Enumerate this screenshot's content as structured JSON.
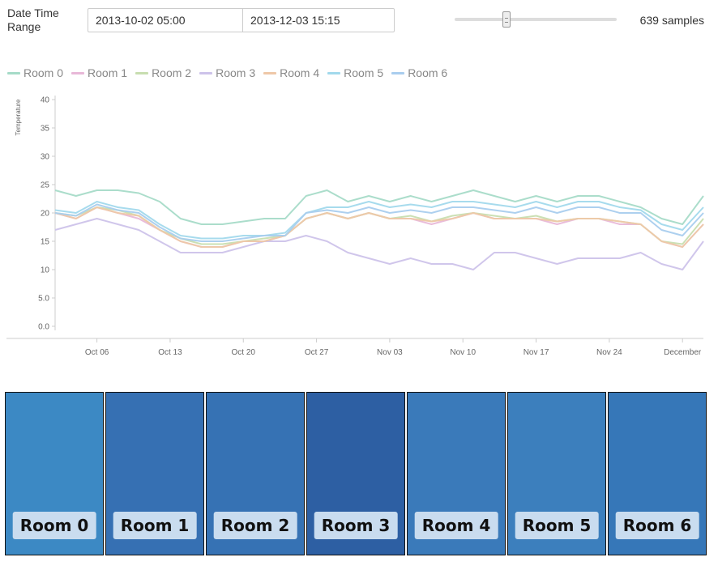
{
  "controls": {
    "date_range_label": "Date Time Range",
    "start_value": "2013-10-02 05:00",
    "end_value": "2013-12-03 15:15",
    "slider_value": 0.31,
    "samples_text": "639 samples"
  },
  "rooms": [
    {
      "name": "Room 0",
      "color": "#3c89c4"
    },
    {
      "name": "Room 1",
      "color": "#3670b3"
    },
    {
      "name": "Room 2",
      "color": "#3672b4"
    },
    {
      "name": "Room 3",
      "color": "#2d5fa3"
    },
    {
      "name": "Room 4",
      "color": "#3a7aba"
    },
    {
      "name": "Room 5",
      "color": "#3c7fbd"
    },
    {
      "name": "Room 6",
      "color": "#3677b8"
    }
  ],
  "chart_data": {
    "type": "line",
    "ylabel": "Temperature",
    "ylim": [
      0,
      40
    ],
    "yticks": [
      0,
      5,
      10,
      15,
      20,
      25,
      30,
      35,
      40
    ],
    "ytick_labels": [
      "0.0",
      "5.0",
      "10",
      "15",
      "20",
      "25",
      "30",
      "35",
      "40"
    ],
    "xlim": [
      "2013-10-02",
      "2013-12-03"
    ],
    "xticks": [
      "2013-10-06",
      "2013-10-13",
      "2013-10-20",
      "2013-10-27",
      "2013-11-03",
      "2013-11-10",
      "2013-11-17",
      "2013-11-24",
      "2013-12-01"
    ],
    "xtick_labels": [
      "Oct 06",
      "Oct 13",
      "Oct 20",
      "Oct 27",
      "Nov 03",
      "Nov 10",
      "Nov 17",
      "Nov 24",
      "December"
    ],
    "x": [
      "2013-10-02",
      "2013-10-04",
      "2013-10-06",
      "2013-10-08",
      "2013-10-10",
      "2013-10-12",
      "2013-10-14",
      "2013-10-16",
      "2013-10-18",
      "2013-10-20",
      "2013-10-22",
      "2013-10-24",
      "2013-10-26",
      "2013-10-28",
      "2013-10-30",
      "2013-11-01",
      "2013-11-03",
      "2013-11-05",
      "2013-11-07",
      "2013-11-09",
      "2013-11-11",
      "2013-11-13",
      "2013-11-15",
      "2013-11-17",
      "2013-11-19",
      "2013-11-21",
      "2013-11-23",
      "2013-11-25",
      "2013-11-27",
      "2013-11-29",
      "2013-12-01",
      "2013-12-03"
    ],
    "legend_position": "top-left",
    "grid": false,
    "series": [
      {
        "name": "Room 0",
        "color": "#a6dbc8",
        "values": [
          24,
          23,
          24,
          24,
          23.5,
          22,
          19,
          18,
          18,
          18.5,
          19,
          19,
          23,
          24,
          22,
          23,
          22,
          23,
          22,
          23,
          24,
          23,
          22,
          23,
          22,
          23,
          23,
          22,
          21,
          19,
          18,
          23
        ]
      },
      {
        "name": "Room 1",
        "color": "#e8b8d8",
        "values": [
          20,
          19,
          21,
          20,
          19,
          17,
          15,
          14,
          14,
          15,
          15,
          16,
          19,
          20,
          19,
          20,
          19,
          19,
          18,
          19,
          20,
          19,
          19,
          19,
          18,
          19,
          19,
          18,
          18,
          15,
          14,
          18
        ]
      },
      {
        "name": "Room 2",
        "color": "#c8deb0",
        "values": [
          20,
          19.5,
          21,
          20.5,
          19.5,
          17,
          15.5,
          14.5,
          14.5,
          15,
          15.5,
          16,
          19,
          20,
          19,
          20,
          19,
          19.5,
          18.5,
          19.5,
          20,
          19.5,
          19,
          19.5,
          18.5,
          19,
          19,
          18.5,
          18,
          15,
          14.5,
          19
        ]
      },
      {
        "name": "Room 3",
        "color": "#cdc3ea",
        "values": [
          17,
          18,
          19,
          18,
          17,
          15,
          13,
          13,
          13,
          14,
          15,
          15,
          16,
          15,
          13,
          12,
          11,
          12,
          11,
          11,
          10,
          13,
          13,
          12,
          11,
          12,
          12,
          12,
          13,
          11,
          10,
          15
        ]
      },
      {
        "name": "Room 4",
        "color": "#eec8a8",
        "values": [
          20,
          19,
          21,
          20,
          19.5,
          17,
          15,
          14,
          14,
          15,
          15,
          16,
          19,
          20,
          19,
          20,
          19,
          19,
          18.5,
          19,
          20,
          19,
          19,
          19,
          18.5,
          19,
          19,
          18.5,
          18,
          15,
          14,
          18
        ]
      },
      {
        "name": "Room 5",
        "color": "#a2d9ec",
        "values": [
          20.5,
          20,
          22,
          21,
          20.5,
          18,
          16,
          15.5,
          15.5,
          16,
          16,
          16.5,
          20,
          21,
          21,
          22,
          21,
          21.5,
          21,
          22,
          22,
          21.5,
          21,
          22,
          21,
          22,
          22,
          21,
          20.5,
          18,
          17,
          21
        ]
      },
      {
        "name": "Room 6",
        "color": "#a9cdee",
        "values": [
          20,
          19.5,
          21.5,
          20.5,
          20,
          17.5,
          15.5,
          15,
          15,
          15.5,
          16,
          16,
          20,
          20.5,
          20,
          21,
          20,
          20.5,
          20,
          21,
          21,
          20.5,
          20,
          21,
          20,
          21,
          21,
          20,
          20,
          17,
          16,
          20
        ]
      }
    ]
  }
}
